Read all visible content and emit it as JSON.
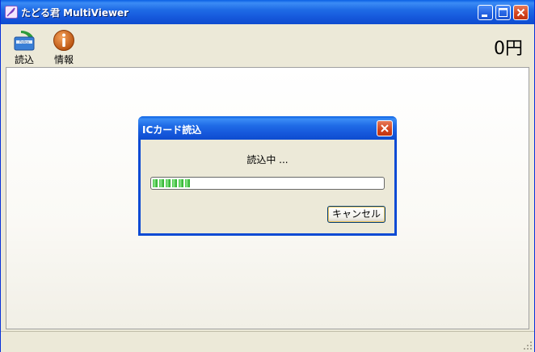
{
  "window": {
    "title": "たどる君 MultiViewer",
    "app_icon": "app-feather-icon",
    "controls": [
      "minimize-icon",
      "maximize-icon",
      "close-icon"
    ]
  },
  "toolbar": {
    "read_label": "読込",
    "read_icon": "card-read-icon",
    "info_label": "情報",
    "info_icon": "info-icon",
    "amount": "0円"
  },
  "dialog": {
    "title": "ICカード読込",
    "message": "読込中 ...",
    "progress_fraction": 0.17,
    "cancel_label": "キャンセル"
  },
  "colors": {
    "titlebar": "#1f6be6",
    "close_button": "#d2421c",
    "progress": "#3dc23d",
    "window_bg": "#ece9d8"
  }
}
